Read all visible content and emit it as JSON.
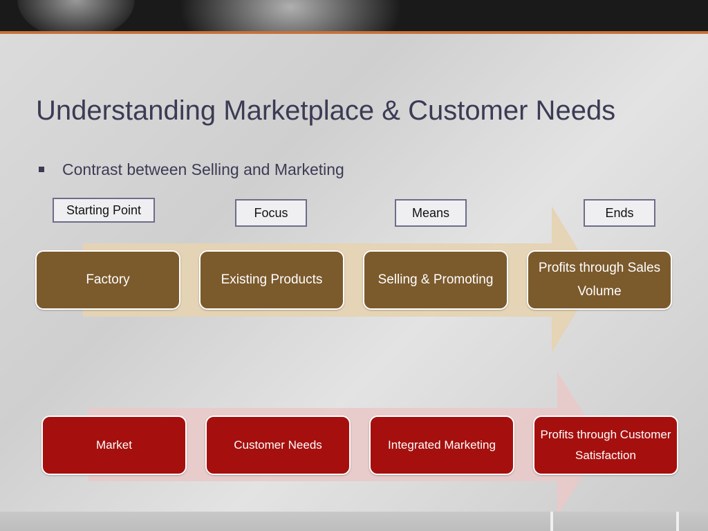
{
  "slide": {
    "title": "Understanding Marketplace & Customer Needs",
    "bullet": "Contrast between Selling and Marketing"
  },
  "labels": {
    "starting_point": "Starting Point",
    "focus": "Focus",
    "means": "Means",
    "ends": "Ends"
  },
  "selling_row": [
    {
      "text": "Factory"
    },
    {
      "text": "Existing Products"
    },
    {
      "text": "Selling & Promoting"
    },
    {
      "text": "Profits through Sales Volume"
    }
  ],
  "marketing_row": [
    {
      "text": "Market"
    },
    {
      "text": "Customer Needs"
    },
    {
      "text": "Integrated Marketing"
    },
    {
      "text": "Profits through Customer Satisfaction"
    }
  ],
  "colors": {
    "accent_orange": "#c8703a",
    "selling_box": "#7b5a2c",
    "selling_arrow": "#e6d3b0",
    "marketing_box": "#a5100e",
    "marketing_arrow": "#e9c9c9",
    "title_text": "#3b3b55"
  }
}
